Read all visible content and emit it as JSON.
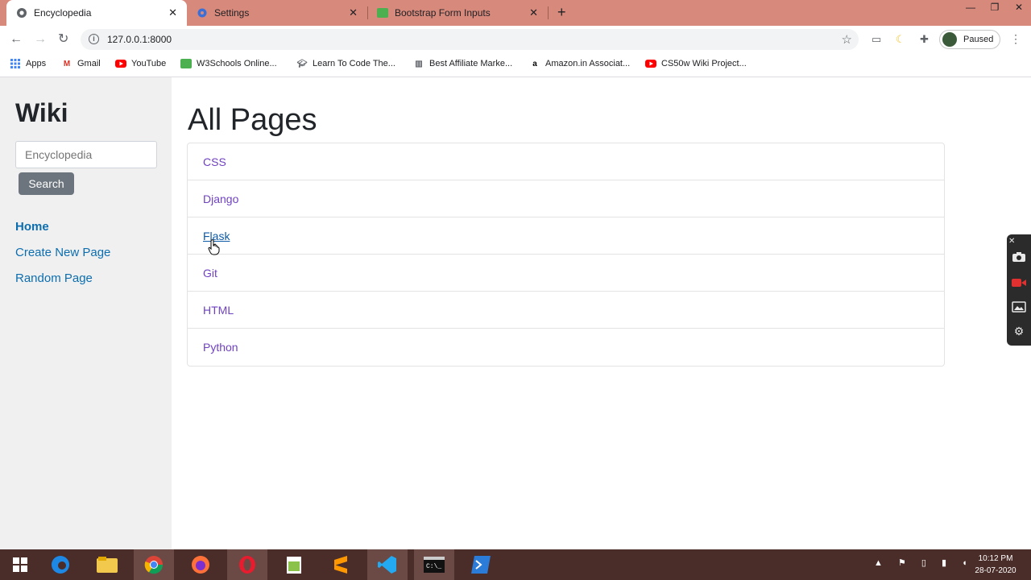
{
  "browser": {
    "tabs": [
      {
        "title": "Encyclopedia",
        "active": true,
        "icon": "chrome-icon"
      },
      {
        "title": "Settings",
        "active": false,
        "icon": "gear-icon"
      },
      {
        "title": "Bootstrap Form Inputs",
        "active": false,
        "icon": "w3schools-icon"
      }
    ],
    "new_tab_glyph": "+",
    "url": "127.0.0.1:8000",
    "profile_label": "Paused",
    "bookmarks": [
      {
        "label": "Apps",
        "icon": "apps-grid-icon"
      },
      {
        "label": "Gmail",
        "icon": "gmail-icon"
      },
      {
        "label": "YouTube",
        "icon": "youtube-icon"
      },
      {
        "label": "W3Schools Online...",
        "icon": "w3schools-icon"
      },
      {
        "label": "Learn To Code The...",
        "icon": "graduation-cap-icon"
      },
      {
        "label": "Best Affiliate Marke...",
        "icon": "building-icon"
      },
      {
        "label": "Amazon.in Associat...",
        "icon": "amazon-icon"
      },
      {
        "label": "CS50w Wiki Project...",
        "icon": "youtube-icon"
      }
    ]
  },
  "sidebar": {
    "title": "Wiki",
    "search_placeholder": "Encyclopedia",
    "search_button": "Search",
    "links": {
      "home": "Home",
      "create": "Create New Page",
      "random": "Random Page"
    }
  },
  "main": {
    "title": "All Pages",
    "entries": [
      "CSS",
      "Django",
      "Flask",
      "Git",
      "HTML",
      "Python"
    ],
    "hovered_entry": "Flask"
  },
  "taskbar": {
    "clock_time": "10:12 PM",
    "clock_date": "28-07-2020"
  },
  "colors": {
    "tab_strip": "#d7897c",
    "link_visited": "#6f42c1",
    "sidebar_link": "#0d6eaf",
    "taskbar": "#4a2c28"
  }
}
